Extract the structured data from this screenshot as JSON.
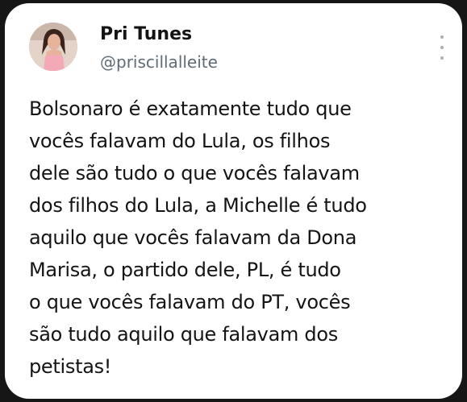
{
  "tweet": {
    "author_name": "Pri Tunes",
    "author_handle": "@priscillalleite",
    "more_icon": "more-vertical-icon",
    "lines": [
      "Bolsonaro é exatamente tudo que",
      "vocês falavam do Lula, os filhos",
      "dele são tudo o que vocês falavam",
      "dos filhos do Lula, a Michelle é tudo",
      "aquilo que vocês falavam da Dona",
      "Marisa, o partido dele, PL, é tudo",
      "o que vocês falavam do PT, vocês",
      "são tudo aquilo que falavam dos",
      "petistas!"
    ]
  },
  "colors": {
    "card_background": "#ffffff",
    "outer_background": "#161616",
    "text": "#141414",
    "handle": "#5f6b75",
    "more_icon": "#a7b0b8"
  }
}
